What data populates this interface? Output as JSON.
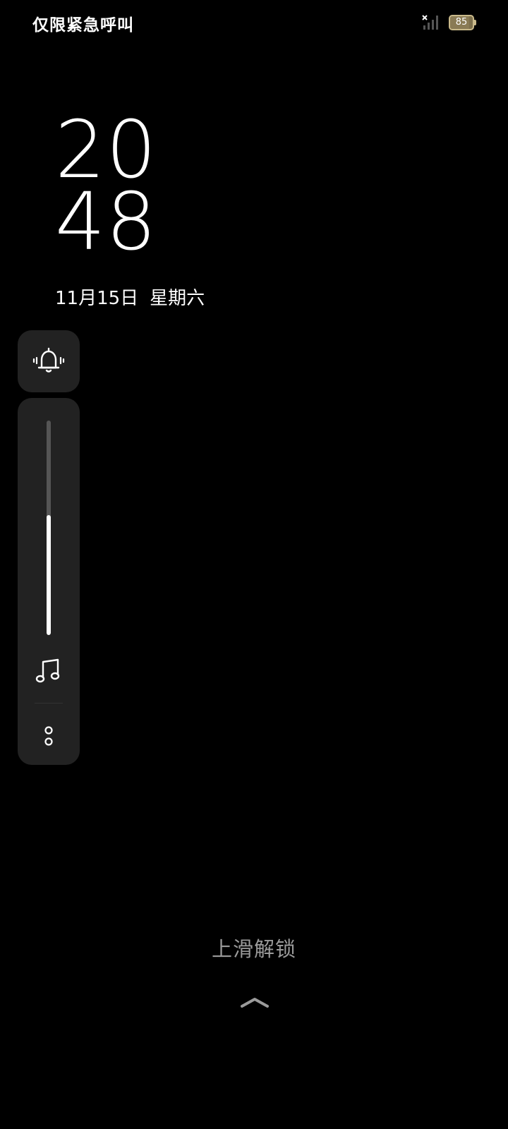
{
  "status_bar": {
    "carrier_text": "仅限紧急呼叫",
    "signal_icon": "no-sim-signal-icon",
    "battery_level": "85",
    "battery_fraction": 0.85
  },
  "clock": {
    "hour": "20",
    "minute": "48"
  },
  "date": {
    "day": "11月15日",
    "weekday": "星期六"
  },
  "volume_panel": {
    "ring_mode_icon": "vibrate-ring-bell-icon",
    "level_fraction": 0.56,
    "stream_icon": "music-note-icon",
    "more_icon": "more-dots-icon"
  },
  "unlock": {
    "hint": "上滑解锁",
    "arrow_icon": "chevron-up-icon"
  },
  "colors": {
    "background": "#000000",
    "panel": "#222222",
    "text": "#ffffff",
    "hint": "#9a9a9a",
    "battery": "#7c6f4c"
  }
}
